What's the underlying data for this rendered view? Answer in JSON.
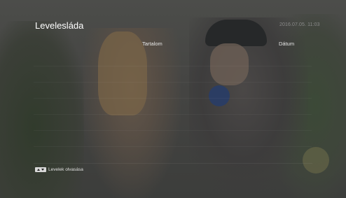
{
  "mailbox": {
    "title": "Levelesláda",
    "datetime": "2016.07.05. 11:03",
    "columns": {
      "content": "Tartalom",
      "date": "Dátum"
    },
    "messages": []
  },
  "footer": {
    "hint_icon": "up-down-keys-icon",
    "hint_label": "Levelek olvasása"
  }
}
